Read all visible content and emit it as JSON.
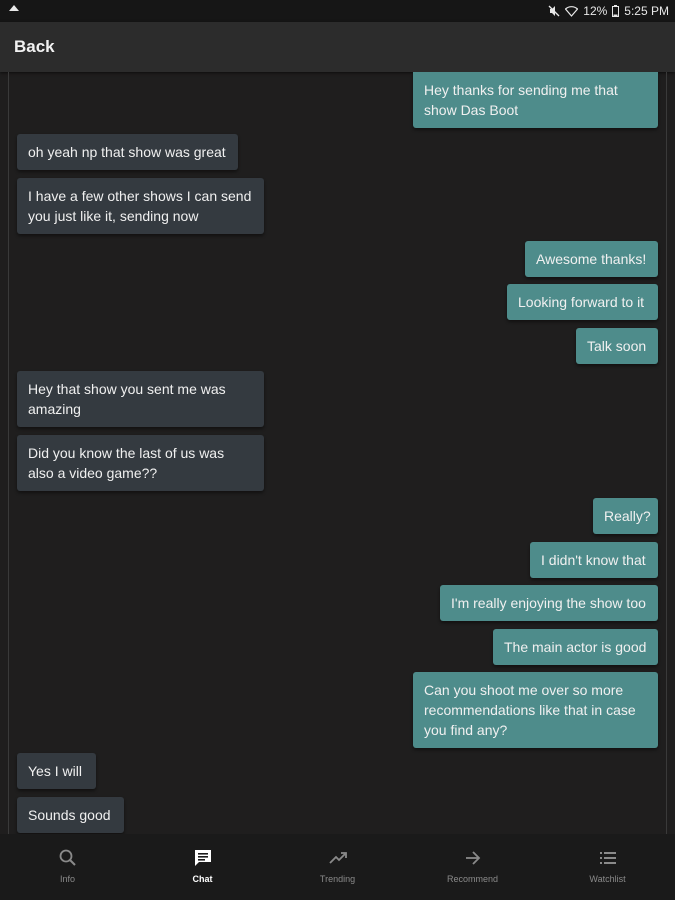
{
  "status_bar": {
    "battery": "12%",
    "time": "5:25 PM"
  },
  "header": {
    "back_label": "Back"
  },
  "messages": [
    {
      "text": "Hey thanks for sending me that show Das Boot",
      "direction": "outgoing"
    },
    {
      "text": "oh yeah np that show was great",
      "direction": "incoming"
    },
    {
      "text": "I have a few other shows I can send you just like it, sending now",
      "direction": "incoming"
    },
    {
      "text": "Awesome thanks!",
      "direction": "outgoing"
    },
    {
      "text": "Looking forward to it",
      "direction": "outgoing"
    },
    {
      "text": "Talk soon",
      "direction": "outgoing"
    },
    {
      "text": "Hey that show you sent me was amazing",
      "direction": "incoming"
    },
    {
      "text": "Did you know the last of us was also a video game??",
      "direction": "incoming"
    },
    {
      "text": "Really?",
      "direction": "outgoing"
    },
    {
      "text": "I didn't know that",
      "direction": "outgoing"
    },
    {
      "text": "I'm really enjoying the show too",
      "direction": "outgoing"
    },
    {
      "text": "The main actor is good",
      "direction": "outgoing"
    },
    {
      "text": "Can you shoot me over so more recommendations like that in case you find any?",
      "direction": "outgoing"
    },
    {
      "text": "Yes I will",
      "direction": "incoming"
    },
    {
      "text": "Sounds good",
      "direction": "incoming"
    }
  ],
  "bottom_nav": [
    {
      "label": "Info",
      "icon": "search-icon",
      "active": false
    },
    {
      "label": "Chat",
      "icon": "chat-icon",
      "active": true
    },
    {
      "label": "Trending",
      "icon": "trending-up-icon",
      "active": false
    },
    {
      "label": "Recommend",
      "icon": "arrow-forward-icon",
      "active": false
    },
    {
      "label": "Watchlist",
      "icon": "list-icon",
      "active": false
    }
  ],
  "colors": {
    "background": "#1f1e1e",
    "incoming_bubble": "#343a40",
    "outgoing_bubble": "#4e8c8b",
    "app_bar": "#2c2c2c"
  }
}
